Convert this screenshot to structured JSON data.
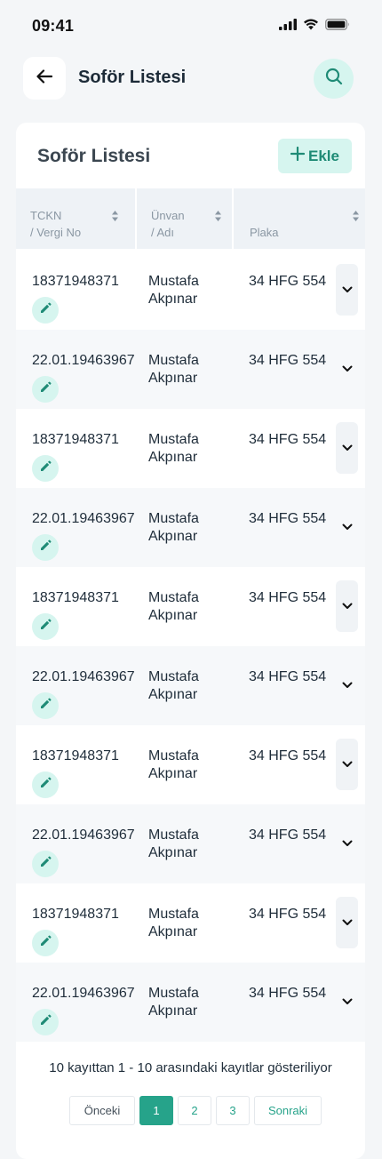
{
  "status_bar": {
    "time": "09:41"
  },
  "header": {
    "title": "Soför Listesi"
  },
  "card": {
    "title": "Soför Listesi",
    "add_label": "Ekle"
  },
  "columns": [
    {
      "line1": "TCKN",
      "line2": "/ Vergi No"
    },
    {
      "line1": "Ünvan",
      "line2": "/ Adı"
    },
    {
      "line1": "Plaka"
    }
  ],
  "rows": [
    {
      "id": "18371948371",
      "name_first": "Mustafa",
      "name_last": "Akpınar",
      "plate": "34 HFG 554"
    },
    {
      "id": "22.01.19463967",
      "name_first": "Mustafa",
      "name_last": "Akpınar",
      "plate": "34 HFG 554"
    },
    {
      "id": "18371948371",
      "name_first": "Mustafa",
      "name_last": "Akpınar",
      "plate": "34 HFG 554"
    },
    {
      "id": "22.01.19463967",
      "name_first": "Mustafa",
      "name_last": "Akpınar",
      "plate": "34 HFG 554"
    },
    {
      "id": "18371948371",
      "name_first": "Mustafa",
      "name_last": "Akpınar",
      "plate": "34 HFG 554"
    },
    {
      "id": "22.01.19463967",
      "name_first": "Mustafa",
      "name_last": "Akpınar",
      "plate": "34 HFG 554"
    },
    {
      "id": "18371948371",
      "name_first": "Mustafa",
      "name_last": "Akpınar",
      "plate": "34 HFG 554"
    },
    {
      "id": "22.01.19463967",
      "name_first": "Mustafa",
      "name_last": "Akpınar",
      "plate": "34 HFG 554"
    },
    {
      "id": "18371948371",
      "name_first": "Mustafa",
      "name_last": "Akpınar",
      "plate": "34 HFG 554"
    },
    {
      "id": "22.01.19463967",
      "name_first": "Mustafa",
      "name_last": "Akpınar",
      "plate": "34 HFG 554"
    }
  ],
  "footer": {
    "info": "10 kayıttan 1 - 10 arasındaki kayıtlar gösteriliyor",
    "prev_label": "Önceki",
    "next_label": "Sonraki",
    "pages": [
      "1",
      "2",
      "3"
    ],
    "active_page": "1"
  },
  "colors": {
    "accent": "#26a38a",
    "accent_light": "#d6f5ef",
    "background": "#f4f6f8"
  },
  "icons": {
    "back": "arrow-left-icon",
    "search": "search-icon",
    "add": "plus-icon",
    "sort": "sort-icon",
    "edit": "pencil-icon",
    "expand": "chevron-down-icon"
  }
}
